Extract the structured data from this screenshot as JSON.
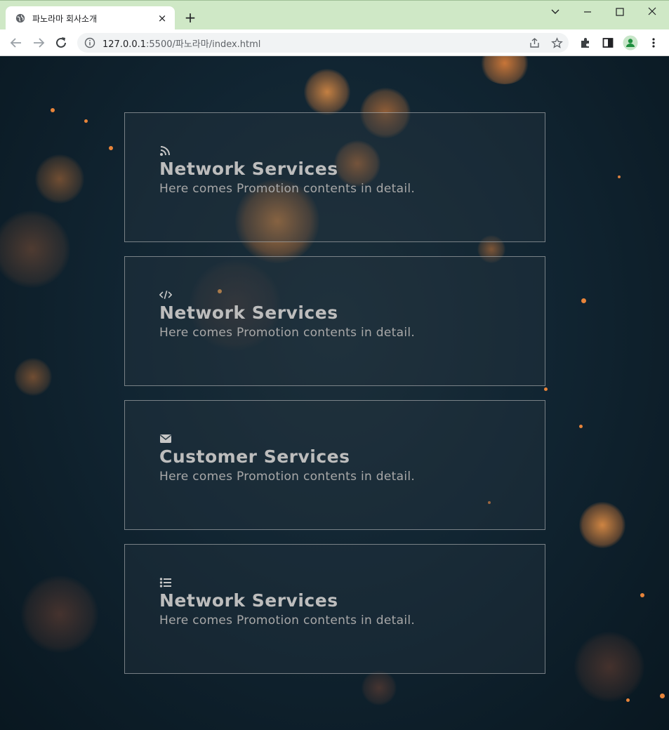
{
  "browser": {
    "tab_title": "파노라마 회사소개",
    "tab_close": "×",
    "new_tab": "+",
    "url_host": "127.0.0.1",
    "url_rest": ":5500/파노라마/index.html"
  },
  "cards": [
    {
      "icon": "rss-icon",
      "title": "Network Services",
      "description": "Here comes Promotion contents in detail."
    },
    {
      "icon": "code-icon",
      "title": "Network Services",
      "description": "Here comes Promotion contents in detail."
    },
    {
      "icon": "envelope-icon",
      "title": "Customer Services",
      "description": "Here comes Promotion contents in detail."
    },
    {
      "icon": "list-icon",
      "title": "Network Services",
      "description": "Here comes Promotion contents in detail."
    }
  ],
  "colors": {
    "background": "#0b1a24",
    "bokeh": "#e8843a",
    "card_border": "#c8c8c8",
    "text": "#bdbdbd"
  }
}
